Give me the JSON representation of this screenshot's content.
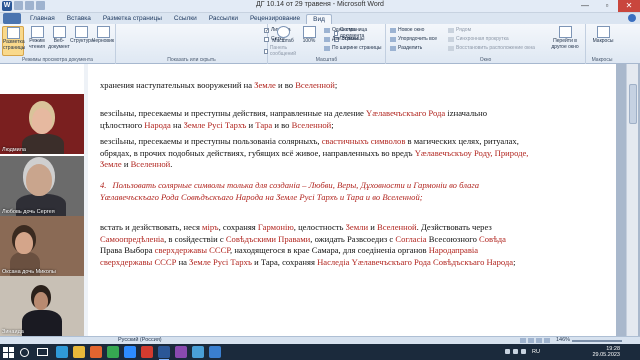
{
  "window": {
    "title": "ДГ 10.14 от 29 травеня - Microsoft Word",
    "controls": {
      "minimize": "—",
      "maximize": "▫",
      "close": "✕"
    }
  },
  "tabs": [
    "Главная",
    "Вставка",
    "Разметка страницы",
    "Ссылки",
    "Рассылки",
    "Рецензирование",
    "Вид"
  ],
  "active_tab": "Вид",
  "ribbon": {
    "views_group": {
      "label": "Режимы просмотра документа",
      "buttons": [
        "Разметка страницы",
        "Режим чтения",
        "Веб-документ",
        "Структура",
        "Черновик"
      ]
    },
    "show_group": {
      "label": "Показать или скрыть",
      "items": [
        {
          "label": "Линейка",
          "checked": true
        },
        {
          "label": "Сетка",
          "checked": false
        },
        {
          "label": "Панель сообщений",
          "checked": false,
          "disabled": true
        },
        {
          "label": "Схема документа",
          "checked": false
        },
        {
          "label": "Эскизы",
          "checked": false
        }
      ]
    },
    "zoom_group": {
      "label": "Масштаб",
      "zoom_button": "Масштаб",
      "percent_button": "100%",
      "items": [
        "Одна страница",
        "Две страницы",
        "По ширине страницы"
      ]
    },
    "window_group": {
      "label": "Окно",
      "items": [
        "Новое окно",
        "Упорядочить все",
        "Разделить"
      ],
      "items_dim": [
        "Рядом",
        "Синхронная прокрутка",
        "Восстановить расположение окна"
      ],
      "switch_button": "Перейти в другое окно"
    },
    "macros_group": {
      "label": "Макросы",
      "button": "Макросы"
    }
  },
  "document": {
    "lines": [
      {
        "parts": [
          {
            "t": "хранения наступательных вооружений на "
          },
          {
            "t": "Ӡемле",
            "r": true
          },
          {
            "t": " и во "
          },
          {
            "t": "Вселенной",
            "r": true
          },
          {
            "t": ";"
          }
        ]
      }
    ],
    "paragraphs": [
      {
        "parts": [
          {
            "t": "везсilьны, пресекаемы и преступны действия, направленные на деление "
          },
          {
            "t": "Үӕлавечъскъаго Рода",
            "r": true
          },
          {
            "t": " izначально цѣлостного "
          },
          {
            "t": "Народа",
            "r": true
          },
          {
            "t": " на "
          },
          {
            "t": "Ӡемле Русi Тархъ",
            "r": true
          },
          {
            "t": " и "
          },
          {
            "t": "Тара",
            "r": true
          },
          {
            "t": " и во "
          },
          {
            "t": "Вселенной",
            "r": true
          },
          {
            "t": ";"
          }
        ]
      },
      {
        "parts": [
          {
            "t": "везсilьны, пресекаемы и преступны пользованiа солярныхъ, "
          },
          {
            "t": "свастичныхъ символов",
            "r": true
          },
          {
            "t": " в магических целях, ритуалах, обрядах, в прочих подобных действиях, губящих всё живое, направленныхъ во вредъ "
          },
          {
            "t": "Үӕлавечъскъоу Роду, Природе, Ӡемле",
            "r": true
          },
          {
            "t": " и "
          },
          {
            "t": "Вселенной",
            "r": true
          },
          {
            "t": "."
          }
        ]
      },
      {
        "red": true,
        "num": "4.",
        "parts": [
          {
            "t": "Пользовать солярные символы толька для созданiа – Любви, Веры, Дұховности и Гармонiи во блага Үӕлавечъскъаго Рода Совѣдъскъаго Народа на Ӡемле Русi Тархъ и Тара и во Вселенной;"
          }
        ]
      },
      {
        "parts": [
          {
            "t": "встать и дезйствовать, неся "
          },
          {
            "t": "міръ",
            "r": true
          },
          {
            "t": ", сохраняя "
          },
          {
            "t": "Гармонiю",
            "r": true
          },
          {
            "t": ", целостность "
          },
          {
            "t": "Ӡемли",
            "r": true
          },
          {
            "t": " и "
          },
          {
            "t": "Вселенной",
            "r": true
          },
          {
            "t": ". Дезйствовать через "
          },
          {
            "t": "Самоопредѣленiа",
            "r": true
          },
          {
            "t": ", в соѕйдествiи с "
          },
          {
            "t": "Совѣдъскими Правами",
            "r": true
          },
          {
            "t": ", ожидать Развсоедиз с "
          },
          {
            "t": "Согласiа",
            "r": true
          },
          {
            "t": " Всесоюзного "
          },
          {
            "t": "Совѣда",
            "r": true
          },
          {
            "t": " Права Выбора "
          },
          {
            "t": "сверхдержавы СССР",
            "r": true
          },
          {
            "t": ", находящегося в крае Самара, для соедiненiа органов "
          },
          {
            "t": "Народаправiа",
            "r": true
          },
          {
            "t": " "
          },
          {
            "t": "сверхдержавы СССР",
            "r": true
          },
          {
            "t": " на "
          },
          {
            "t": "Ӡемле Русi Тархъ",
            "r": true
          },
          {
            "t": " и Тара, сохраняя "
          },
          {
            "t": "Наследiа Үӕлавечъскъаго Рода Совѣдъскъаго Народа",
            "r": true
          },
          {
            "t": ";"
          }
        ]
      }
    ]
  },
  "video_participants": [
    {
      "name": "Людмила",
      "bg": "#7a1f1f",
      "skin": "#e6b9a0",
      "hair": "#d9c39a",
      "cloth": "#3b2e2a"
    },
    {
      "name": "Любовь дочь Сергея",
      "bg": "#6b6b6b",
      "skin": "#c9a58d",
      "hair": "#cfcfcf",
      "cloth": "#2f2f36"
    },
    {
      "name": "Оксана дочь Миколы",
      "bg": "#8a6a55",
      "skin": "#d4a58a",
      "hair": "#3a2a20",
      "cloth": "#6a5040"
    },
    {
      "name": "Зинаида",
      "bg": "#c8c0b5",
      "skin": "#b88a70",
      "hair": "#2a201a",
      "cloth": "#1a1a22"
    }
  ],
  "statusbar": {
    "language": "Русский (Россия)",
    "zoom": "146%"
  },
  "taskbar": {
    "language": "RU",
    "time": "19:28",
    "date": "29.05.2023",
    "apps": [
      {
        "name": "edge-icon",
        "color": "#2f9ad8"
      },
      {
        "name": "explorer-icon",
        "color": "#e9b93a"
      },
      {
        "name": "firefox-icon",
        "color": "#e2652f"
      },
      {
        "name": "chrome-icon",
        "color": "#36a852"
      },
      {
        "name": "zoom-icon",
        "color": "#2d8cff"
      },
      {
        "name": "yandex-icon",
        "color": "#d33b2f"
      },
      {
        "name": "word-icon",
        "color": "#2b5797"
      },
      {
        "name": "media-icon",
        "color": "#8a4ab0"
      },
      {
        "name": "store-icon",
        "color": "#4aa0d8"
      },
      {
        "name": "mail-icon",
        "color": "#3a7fd0"
      }
    ]
  }
}
